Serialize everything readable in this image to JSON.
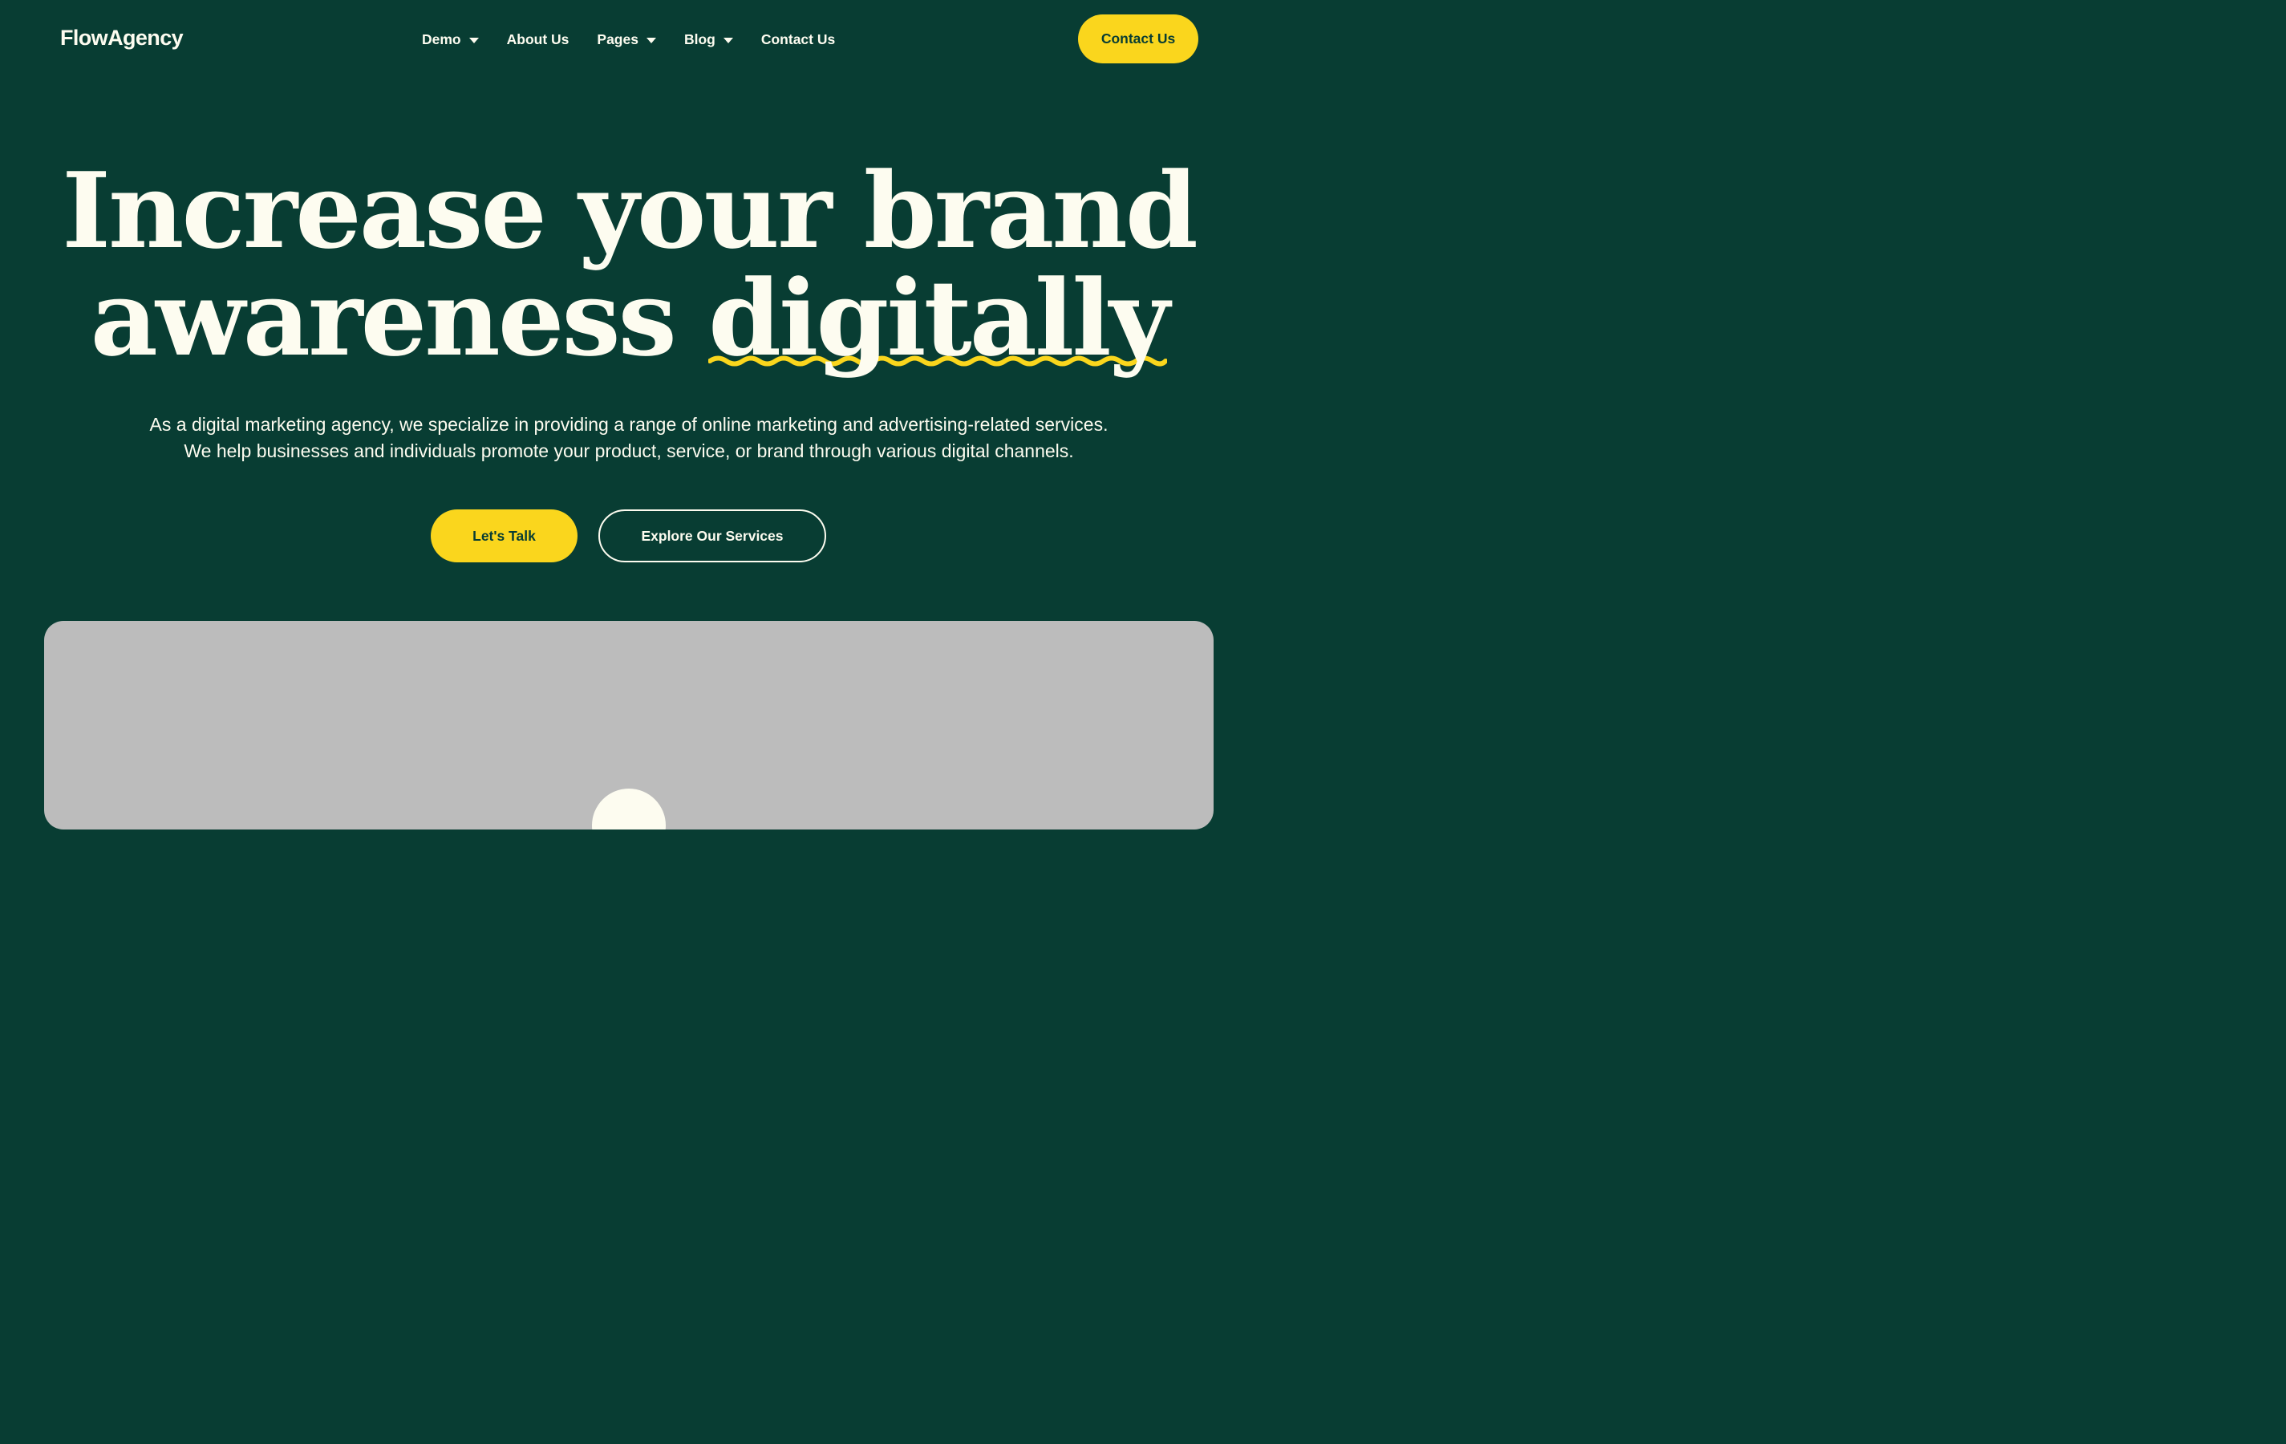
{
  "brand": {
    "name": "FlowAgency"
  },
  "nav": {
    "items": [
      {
        "label": "Demo",
        "has_dropdown": true
      },
      {
        "label": "About Us",
        "has_dropdown": false
      },
      {
        "label": "Pages",
        "has_dropdown": true
      },
      {
        "label": "Blog",
        "has_dropdown": true
      },
      {
        "label": "Contact Us",
        "has_dropdown": false
      }
    ],
    "cta_label": "Contact Us"
  },
  "hero": {
    "title_line1": "Increase your brand",
    "title_line2_prefix": "awareness",
    "title_highlight": "digitally",
    "subtitle_line1": "As a digital marketing agency, we specialize in providing a range of online marketing and advertising-related services.",
    "subtitle_line2": "We help businesses and individuals promote your product, service, or brand through various digital channels.",
    "primary_button": "Let's Talk",
    "secondary_button": "Explore Our Services"
  },
  "media": {
    "icon": "play-icon"
  },
  "colors": {
    "background": "#083d33",
    "accent": "#fad61d",
    "text": "#fdfcf0",
    "media_placeholder": "#bcbcbc"
  }
}
